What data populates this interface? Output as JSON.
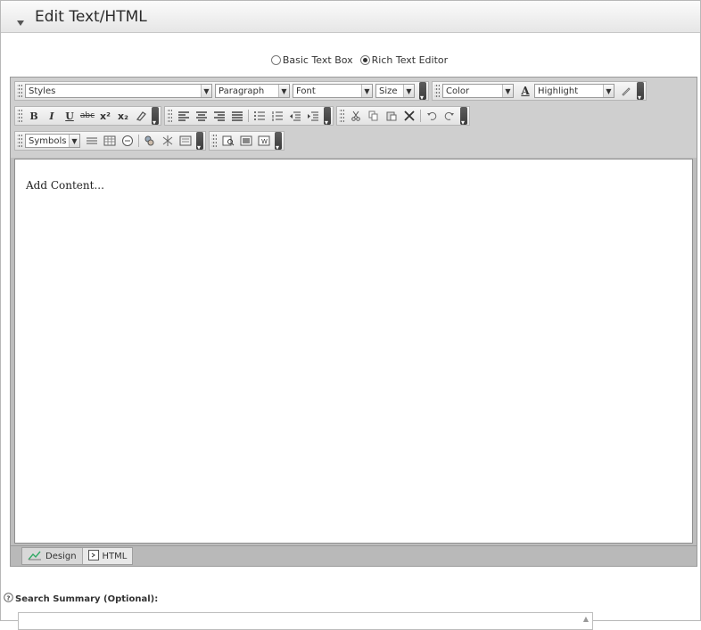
{
  "header": {
    "title": "Edit Text/HTML"
  },
  "editor_mode": {
    "basic_label": "Basic Text Box",
    "rich_label": "Rich Text Editor",
    "selected": "rich"
  },
  "toolbar": {
    "styles": "Styles",
    "paragraph": "Paragraph",
    "font": "Font",
    "size": "Size",
    "color": "Color",
    "highlight": "Highlight",
    "symbols": "Symbols",
    "bold_glyph": "B",
    "italic_glyph": "I",
    "underline_glyph": "U",
    "strike_glyph": "abc",
    "superscript_glyph": "x²",
    "subscript_glyph": "x₂",
    "text_color_glyph": "A"
  },
  "content": {
    "placeholder": "Add Content..."
  },
  "tabs": [
    {
      "label": "Design",
      "icon": "design-icon",
      "active": true
    },
    {
      "label": "HTML",
      "icon": "html-icon",
      "active": false
    }
  ],
  "search_summary": {
    "label": "Search Summary (Optional):"
  },
  "colors": {
    "header_bg": "#ebebeb",
    "toolbar_bg": "#cfcfcf",
    "tab_bar_bg": "#b9b9b9"
  }
}
